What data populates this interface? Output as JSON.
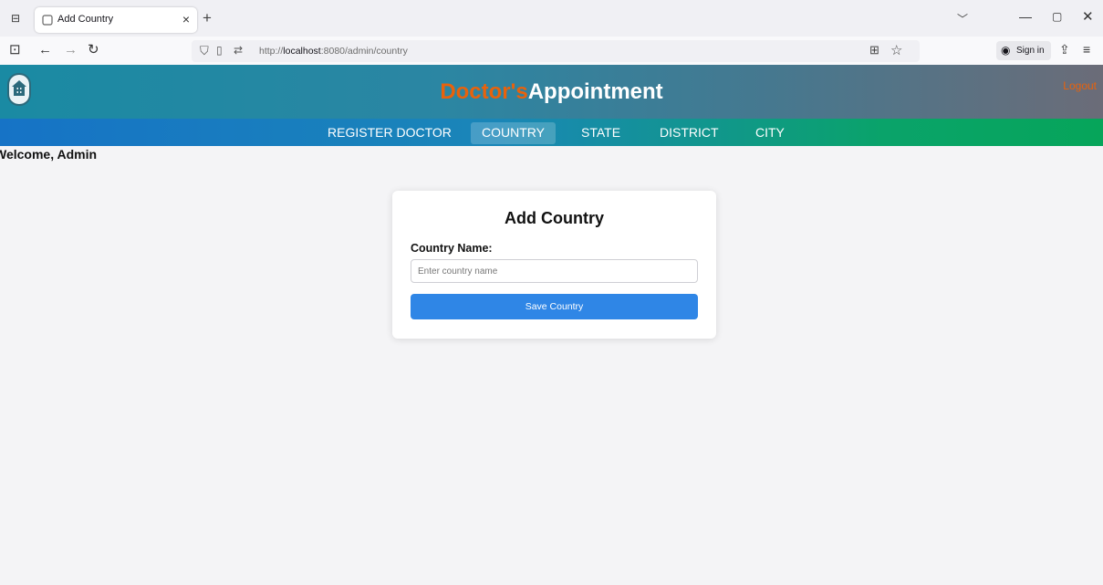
{
  "browser": {
    "tab_title": "Add Country",
    "url_prefix": "http://",
    "url_host": "localhost",
    "url_path": ":8080/admin/country",
    "signin_label": "Sign in"
  },
  "header": {
    "brand_part1": "Doctor's",
    "brand_part2": "Appointment",
    "logout_label": "Logout"
  },
  "menu": {
    "items": [
      {
        "label": "REGISTER DOCTOR"
      },
      {
        "label": "COUNTRY"
      },
      {
        "label": "STATE"
      },
      {
        "label": "DISTRICT"
      },
      {
        "label": "CITY"
      }
    ],
    "active": "COUNTRY"
  },
  "welcome_text": "Welcome, Admin",
  "form": {
    "title": "Add Country",
    "country_label": "Country Name:",
    "country_placeholder": "Enter country name",
    "country_value": "",
    "save_label": "Save Country"
  },
  "colors": {
    "brand_orange": "#e8620c",
    "button_blue": "#2f86e6"
  }
}
